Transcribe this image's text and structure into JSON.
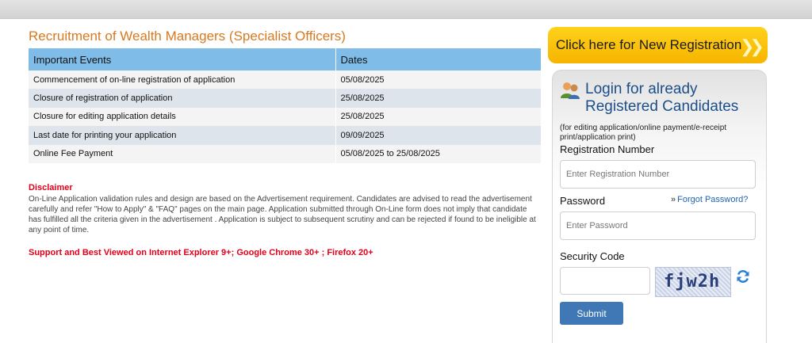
{
  "page_title": "Recruitment of Wealth Managers (Specialist Officers)",
  "events_table": {
    "headers": [
      "Important Events",
      "Dates"
    ],
    "rows": [
      {
        "event": "Commencement of on-line registration of application",
        "date": "05/08/2025"
      },
      {
        "event": "Closure of registration of application",
        "date": "25/08/2025"
      },
      {
        "event": "Closure for editing application details",
        "date": "25/08/2025"
      },
      {
        "event": "Last date for printing your application",
        "date": "09/09/2025"
      },
      {
        "event": "Online Fee Payment",
        "date": "05/08/2025 to 25/08/2025"
      }
    ]
  },
  "disclaimer": {
    "title": "Disclaimer",
    "text": "On-Line Application validation rules and design are based on the Advertisement requirement. Candidates are advised to read the advertisement carefully and refer \"How to Apply\" & \"FAQ\" pages on the main page. Application submitted through On-Line form does not imply that candidate has fulfilled all the criteria given in the advertisement . Application is subject to subsequent scrutiny and can be rejected if found to be ineligible at any point of time."
  },
  "support_note": "Support and Best Viewed on Internet Explorer 9+; Google Chrome 30+ ; Firefox 20+",
  "new_registration_label": "Click here for New Registration",
  "login": {
    "title": "Login for already Registered Candidates",
    "subtitle": "(for editing application/online payment/e-receipt print/application print)",
    "registration_label": "Registration Number",
    "registration_placeholder": "Enter Registration Number",
    "password_label": "Password",
    "password_placeholder": "Enter Password",
    "forgot_label": "Forgot Password?",
    "security_label": "Security Code",
    "captcha_text": "fjw2h",
    "submit_label": "Submit"
  },
  "colors": {
    "title_orange": "#d9791f",
    "header_blue": "#7fbde8",
    "alert_red": "#e2001a",
    "button_yellow": "#f6b400",
    "submit_blue": "#3f78b5"
  }
}
